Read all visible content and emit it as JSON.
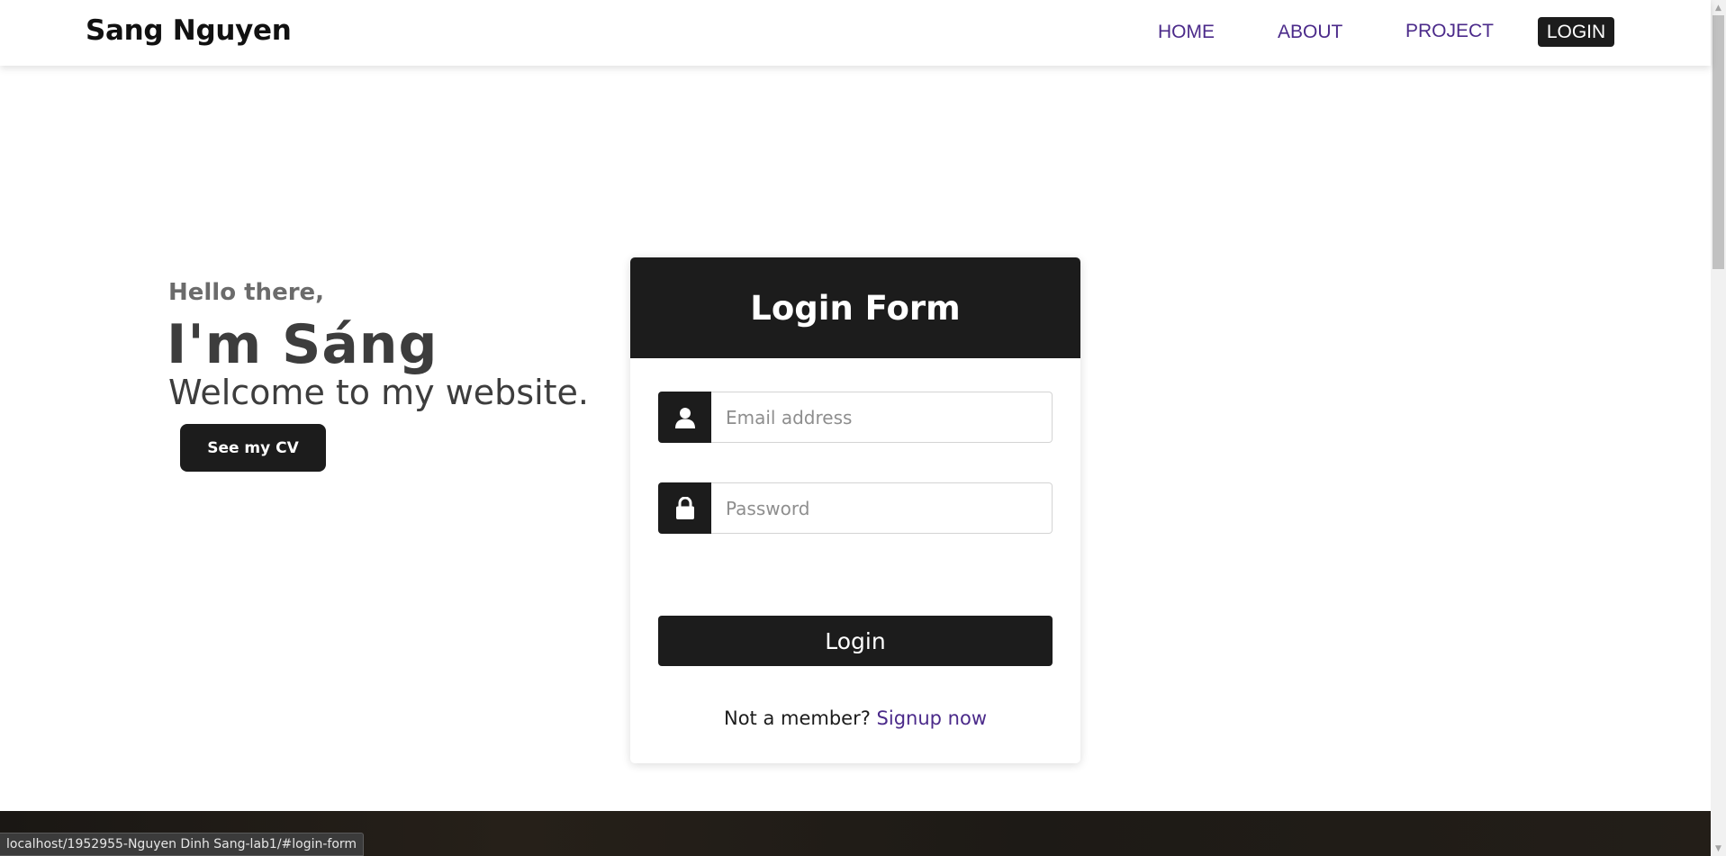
{
  "navbar": {
    "brand": "Sang Nguyen",
    "links": {
      "home": "HOME",
      "about": "ABOUT",
      "project": "PROJECT",
      "login": "LOGIN"
    },
    "link_color": "#4b2a8a"
  },
  "hero": {
    "greeting": "Hello there,",
    "name": "I'm Sáng",
    "welcome": "Welcome to my website.",
    "cv_button": "See my CV"
  },
  "login_form": {
    "title": "Login Form",
    "email": {
      "icon": "user-icon",
      "placeholder": "Email address",
      "value": ""
    },
    "password": {
      "icon": "lock-icon",
      "placeholder": "Password",
      "value": ""
    },
    "submit_label": "Login",
    "signup_prompt": "Not a member?",
    "signup_link": "Signup now"
  },
  "status_bar": {
    "url": "localhost/1952955-Nguyen Dinh Sang-lab1/#login-form"
  },
  "colors": {
    "dark": "#1c1c1c",
    "accent": "#4b2a8a",
    "background": "#ffffff"
  }
}
